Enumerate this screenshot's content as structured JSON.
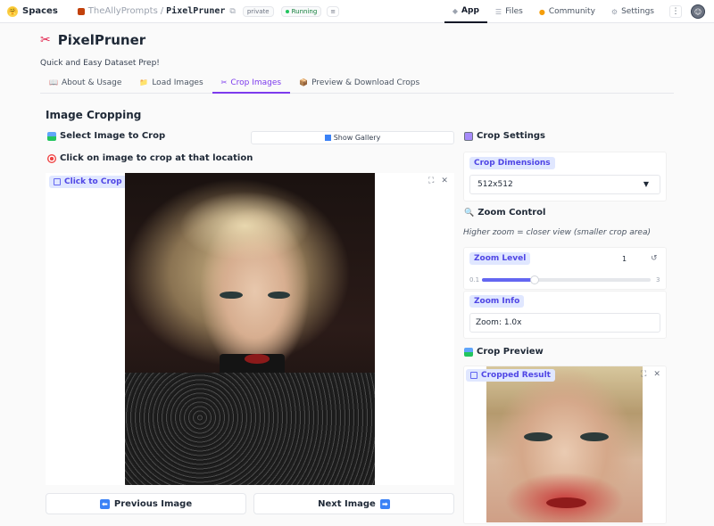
{
  "topbar": {
    "brand": "Spaces",
    "owner": "TheAllyPrompts",
    "separator": "/",
    "repo": "PixelPruner",
    "visibility": "private",
    "status": "Running",
    "nav": [
      {
        "label": "App",
        "icon": "app-icon",
        "active": true
      },
      {
        "label": "Files",
        "icon": "files-icon",
        "active": false
      },
      {
        "label": "Community",
        "icon": "community-icon",
        "active": false
      },
      {
        "label": "Settings",
        "icon": "gear-icon",
        "active": false
      }
    ],
    "kebab": "⋮"
  },
  "app": {
    "title": "PixelPruner",
    "subtitle": "Quick and Easy Dataset Prep!",
    "tabs": [
      {
        "label": "About & Usage",
        "active": false
      },
      {
        "label": "Load Images",
        "active": false
      },
      {
        "label": "Crop Images",
        "active": true
      },
      {
        "label": "Preview & Download Crops",
        "active": false
      }
    ]
  },
  "main": {
    "section_title": "Image Cropping",
    "select_label": "Select Image to Crop",
    "show_gallery": "Show Gallery",
    "click_label": "Click on image to crop at that location",
    "image_badge": "Click to Crop",
    "prev_button": "Previous Image",
    "next_button": "Next Image"
  },
  "settings": {
    "title": "Crop Settings",
    "dimensions_label": "Crop Dimensions",
    "dimensions_value": "512x512",
    "zoom_title": "Zoom Control",
    "zoom_hint": "Higher zoom = closer view (smaller crop area)",
    "zoom_label": "Zoom Level",
    "zoom_value": "1",
    "zoom_min": "0.1",
    "zoom_max": "3",
    "zoom_fraction": 0.31,
    "info_label": "Zoom Info",
    "info_value": "Zoom: 1.0x",
    "preview_title": "Crop Preview",
    "preview_badge": "Cropped Result"
  },
  "colors": {
    "accent": "#6366f1",
    "active_tab": "#7c3aed",
    "running": "#22c55e"
  }
}
